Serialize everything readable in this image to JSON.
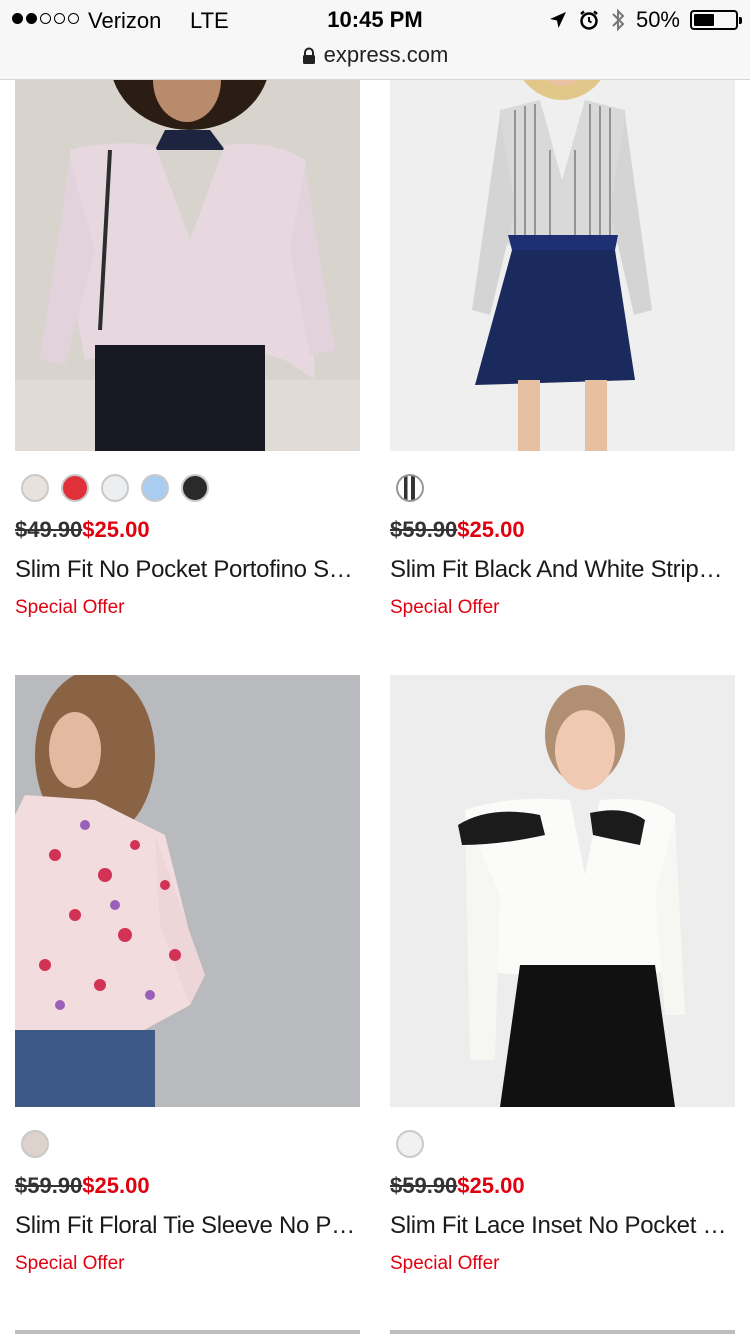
{
  "status_bar": {
    "carrier": "Verizon",
    "network": "LTE",
    "time": "10:45 PM",
    "battery_text": "50%",
    "battery_level": 0.5,
    "signal_bars_filled": 2,
    "signal_bars_total": 5,
    "icons": [
      "location-arrow-icon",
      "alarm-icon",
      "bluetooth-icon"
    ]
  },
  "url_bar": {
    "domain": "express.com",
    "icon": "lock-icon"
  },
  "products": [
    {
      "swatches": [
        "#e8e2dc",
        "#e0303a",
        "#eceef0",
        "#a9cdf0",
        "#2a2a2a"
      ],
      "old_price": "$49.90",
      "new_price": "$25.00",
      "name": "Slim Fit No Pocket Portofino Shirt",
      "offer": "Special Offer"
    },
    {
      "swatches": [
        "striped"
      ],
      "old_price": "$59.90",
      "new_price": "$25.00",
      "name": "Slim Fit Black And White Stripe Shirt",
      "offer": "Special Offer"
    },
    {
      "swatches": [
        "#ddd3cc"
      ],
      "old_price": "$59.90",
      "new_price": "$25.00",
      "name": "Slim Fit Floral Tie Sleeve No Pocket Shirt",
      "offer": "Special Offer"
    },
    {
      "swatches": [
        "#f1f1f1"
      ],
      "old_price": "$59.90",
      "new_price": "$25.00",
      "name": "Slim Fit Lace Inset No Pocket Shirt",
      "offer": "Special Offer"
    }
  ],
  "colors": {
    "sale_red": "#e1000f"
  }
}
